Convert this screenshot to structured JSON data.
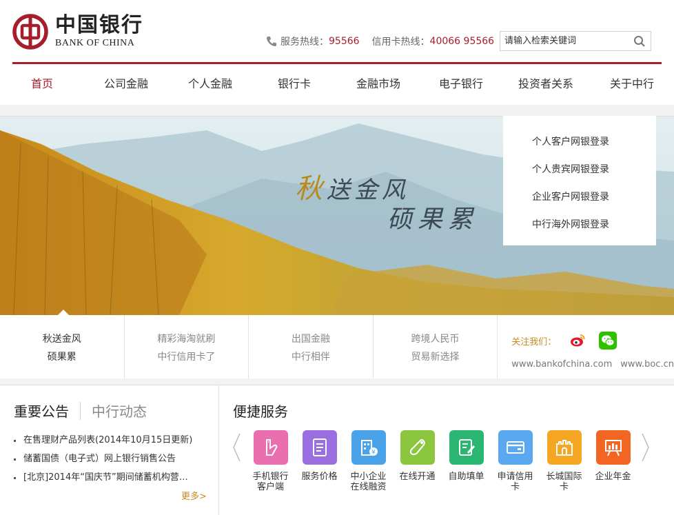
{
  "brand": {
    "name_cn": "中国银行",
    "name_en": "BANK OF CHINA",
    "color": "#a61e2c"
  },
  "hotlines": {
    "service_label": "服务热线：",
    "service_number": "95566",
    "card_label": "信用卡热线：",
    "card_number": "40066 95566"
  },
  "search": {
    "placeholder": "请输入检索关键词"
  },
  "nav": [
    "首页",
    "公司金融",
    "个人金融",
    "银行卡",
    "金融市场",
    "电子银行",
    "投资者关系",
    "关于中行"
  ],
  "banner": {
    "slogan_accent": "秋",
    "slogan_line1": "送金风",
    "slogan_line2": "硕果累"
  },
  "login_links": [
    "个人客户网银登录",
    "个人贵宾网银登录",
    "企业客户网银登录",
    "中行海外网银登录"
  ],
  "banner_tabs": [
    {
      "line1": "秋送金风",
      "line2": "硕果累"
    },
    {
      "line1": "精彩海淘就刷",
      "line2": "中行信用卡了"
    },
    {
      "line1": "出国金融",
      "line2": "中行相伴"
    },
    {
      "line1": "跨境人民币",
      "line2": "贸易新选择"
    }
  ],
  "follow": {
    "label": "关注我们：",
    "icons": [
      "weibo-icon",
      "wechat-icon"
    ],
    "url1": "www.bankofchina.com",
    "url2": "www.boc.cn"
  },
  "notice": {
    "tab_active": "重要公告",
    "tab_inactive": "中行动态",
    "items": [
      "在售理财产品列表(2014年10月15日更新)",
      "储蓄国债（电子式）网上银行销售公告",
      "[北京]2014年“国庆节”期间储蓄机构营…"
    ],
    "more": "更多>"
  },
  "services": {
    "title": "便捷服务",
    "items": [
      {
        "line1": "手机银行",
        "line2": "客户端",
        "color": "#ea6fb0",
        "icon": "mobile-hand-icon"
      },
      {
        "line1": "服务价格",
        "line2": "",
        "color": "#9b6fe0",
        "icon": "price-list-icon"
      },
      {
        "line1": "中小企业",
        "line2": "在线融资",
        "color": "#4aa3e8",
        "icon": "building-yuan-icon"
      },
      {
        "line1": "在线开通",
        "line2": "",
        "color": "#8cc63f",
        "icon": "touch-hand-icon"
      },
      {
        "line1": "自助填单",
        "line2": "",
        "color": "#2bb673",
        "icon": "form-pen-icon"
      },
      {
        "line1": "申请信用",
        "line2": "卡",
        "color": "#5aa9f0",
        "icon": "credit-card-icon"
      },
      {
        "line1": "长城国际",
        "line2": "卡",
        "color": "#f5a623",
        "icon": "great-wall-icon"
      },
      {
        "line1": "企业年金",
        "line2": "",
        "color": "#f26522",
        "icon": "chart-board-icon"
      }
    ]
  }
}
